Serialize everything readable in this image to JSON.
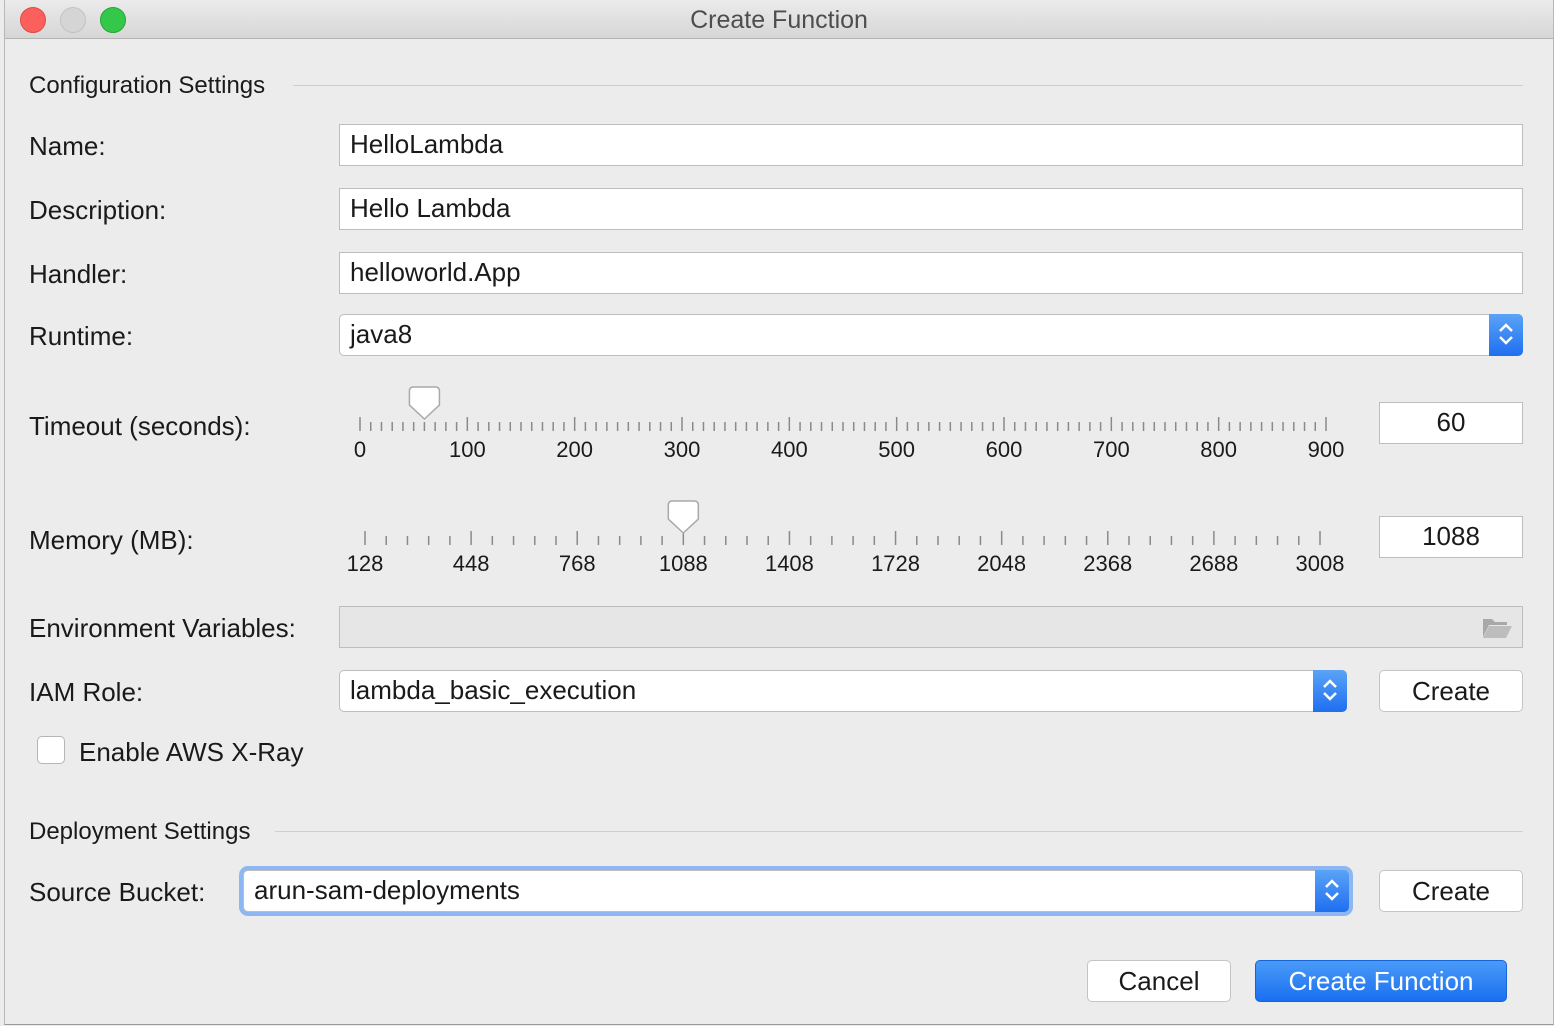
{
  "window": {
    "title": "Create Function"
  },
  "config": {
    "section_title": "Configuration Settings",
    "name_label": "Name:",
    "name_value": "HelloLambda",
    "description_label": "Description:",
    "description_value": "Hello Lambda",
    "handler_label": "Handler:",
    "handler_value": "helloworld.App",
    "runtime_label": "Runtime:",
    "runtime_value": "java8",
    "timeout_label": "Timeout (seconds):",
    "timeout_value": "60",
    "timeout_ticks": [
      "0",
      "100",
      "200",
      "300",
      "400",
      "500",
      "600",
      "700",
      "800",
      "900"
    ],
    "timeout_fraction": 0.0667,
    "memory_label": "Memory (MB):",
    "memory_value": "1088",
    "memory_ticks": [
      "128",
      "448",
      "768",
      "1088",
      "1408",
      "1728",
      "2048",
      "2368",
      "2688",
      "3008"
    ],
    "memory_fraction": 0.3333,
    "env_label": "Environment Variables:",
    "env_value": "",
    "iam_label": "IAM Role:",
    "iam_value": "lambda_basic_execution",
    "iam_create_label": "Create",
    "xray_label": "Enable AWS X-Ray",
    "xray_checked": false
  },
  "deployment": {
    "section_title": "Deployment Settings",
    "bucket_label": "Source Bucket:",
    "bucket_value": "arun-sam-deployments",
    "bucket_create_label": "Create"
  },
  "footer": {
    "cancel_label": "Cancel",
    "submit_label": "Create Function"
  },
  "colors": {
    "accent": "#1f6ff0",
    "close": "#fc605c",
    "maximize": "#34c84a"
  }
}
